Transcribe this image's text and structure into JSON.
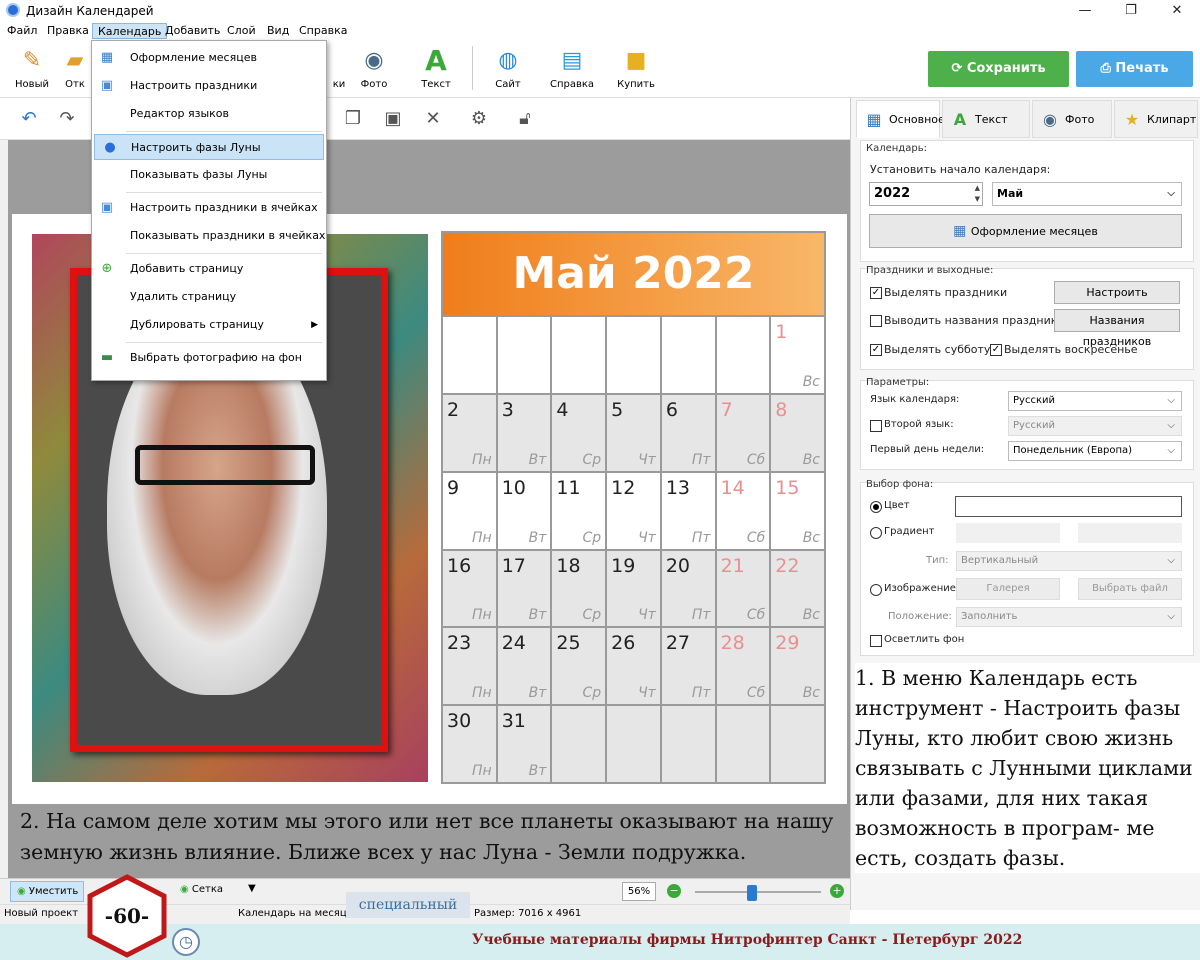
{
  "window": {
    "title": "Дизайн Календарей",
    "controls": {
      "minimize": "—",
      "maximize": "❐",
      "close": "✕"
    }
  },
  "menubar": {
    "items": [
      "Файл",
      "Правка",
      "Календарь",
      "Добавить",
      "Слой",
      "Вид",
      "Справка"
    ],
    "active": "Календарь"
  },
  "toolbar": {
    "buttons": [
      {
        "label": "Новый",
        "icon": "new-icon"
      },
      {
        "label": "Отк",
        "icon": "open-icon"
      },
      {
        "label": "ки",
        "icon": "clipart-icon"
      },
      {
        "label": "Фото",
        "icon": "camera-icon"
      },
      {
        "label": "Текст",
        "icon": "text-icon"
      },
      {
        "label": "Сайт",
        "icon": "globe-icon"
      },
      {
        "label": "Справка",
        "icon": "book-icon"
      },
      {
        "label": "Купить",
        "icon": "bag-icon"
      }
    ],
    "save_label": "Сохранить",
    "print_label": "Печать",
    "save_color": "#4eb04a",
    "print_color": "#4aa8e6"
  },
  "dropdown": {
    "items": [
      {
        "label": "Оформление месяцев",
        "icon": "calendar-grid-icon"
      },
      {
        "label": "Настроить праздники",
        "icon": "calendar-31-icon"
      },
      {
        "label": "Редактор языков",
        "icon": ""
      },
      {
        "label": "Настроить фазы Луны",
        "icon": "moon-icon",
        "highlighted": true
      },
      {
        "label": "Показывать фазы Луны",
        "icon": ""
      },
      {
        "label": "Настроить праздники в ячейках",
        "icon": "calendar-31-icon"
      },
      {
        "label": "Показывать праздники в ячейках",
        "icon": ""
      },
      {
        "label": "Добавить страницу",
        "icon": "add-page-icon"
      },
      {
        "label": "Удалить страницу",
        "icon": ""
      },
      {
        "label": "Дублировать страницу",
        "icon": "",
        "submenu": true
      },
      {
        "label": "Выбрать фотографию на фон",
        "icon": "photo-icon"
      }
    ]
  },
  "calendar": {
    "title": "Май 2022",
    "weekdays": [
      "Пн",
      "Вт",
      "Ср",
      "Чт",
      "Пт",
      "Сб",
      "Вс"
    ],
    "cells": [
      {
        "n": "",
        "d": ""
      },
      {
        "n": "",
        "d": ""
      },
      {
        "n": "",
        "d": ""
      },
      {
        "n": "",
        "d": ""
      },
      {
        "n": "",
        "d": ""
      },
      {
        "n": "",
        "d": ""
      },
      {
        "n": "1",
        "d": "Вс"
      },
      {
        "n": "2",
        "d": "Пн"
      },
      {
        "n": "3",
        "d": "Вт"
      },
      {
        "n": "4",
        "d": "Ср"
      },
      {
        "n": "5",
        "d": "Чт"
      },
      {
        "n": "6",
        "d": "Пт"
      },
      {
        "n": "7",
        "d": "Сб"
      },
      {
        "n": "8",
        "d": "Вс"
      },
      {
        "n": "9",
        "d": "Пн"
      },
      {
        "n": "10",
        "d": "Вт"
      },
      {
        "n": "11",
        "d": "Ср"
      },
      {
        "n": "12",
        "d": "Чт"
      },
      {
        "n": "13",
        "d": "Пт"
      },
      {
        "n": "14",
        "d": "Сб"
      },
      {
        "n": "15",
        "d": "Вс"
      },
      {
        "n": "16",
        "d": "Пн"
      },
      {
        "n": "17",
        "d": "Вт"
      },
      {
        "n": "18",
        "d": "Ср"
      },
      {
        "n": "19",
        "d": "Чт"
      },
      {
        "n": "20",
        "d": "Пт"
      },
      {
        "n": "21",
        "d": "Сб"
      },
      {
        "n": "22",
        "d": "Вс"
      },
      {
        "n": "23",
        "d": "Пн"
      },
      {
        "n": "24",
        "d": "Вт"
      },
      {
        "n": "25",
        "d": "Ср"
      },
      {
        "n": "26",
        "d": "Чт"
      },
      {
        "n": "27",
        "d": "Пт"
      },
      {
        "n": "28",
        "d": "Сб"
      },
      {
        "n": "29",
        "d": "Вс"
      },
      {
        "n": "30",
        "d": "Пн"
      },
      {
        "n": "31",
        "d": "Вт"
      },
      {
        "n": "",
        "d": ""
      },
      {
        "n": "",
        "d": ""
      },
      {
        "n": "",
        "d": ""
      },
      {
        "n": "",
        "d": ""
      },
      {
        "n": "",
        "d": ""
      }
    ],
    "header_color_start": "#f07d1a",
    "header_color_end": "#f8b768",
    "weekend_color": "#e89090"
  },
  "panel": {
    "tabs": [
      {
        "label": "Основное",
        "icon": "calendar-tab-icon"
      },
      {
        "label": "Текст",
        "icon": "text-tab-icon"
      },
      {
        "label": "Фото",
        "icon": "photo-tab-icon"
      },
      {
        "label": "Клипарт",
        "icon": "star-icon"
      }
    ],
    "calendar_group": {
      "title": "Календарь:",
      "start_label": "Установить начало календаря:",
      "year": "2022",
      "month": "Май",
      "design_button": "Оформление месяцев"
    },
    "holidays_group": {
      "title": "Праздники и выходные:",
      "highlight_holidays": "Выделять праздники",
      "highlight_holidays_checked": true,
      "setup_holidays_button": "Настроить праздники",
      "show_names": "Выводить названия праздников",
      "show_names_checked": false,
      "names_button": "Названия праздников",
      "highlight_saturday": "Выделять субботу",
      "highlight_saturday_checked": true,
      "highlight_sunday": "Выделять воскресенье",
      "highlight_sunday_checked": true
    },
    "params_group": {
      "title": "Параметры:",
      "lang_label": "Язык календаря:",
      "lang_value": "Русский",
      "second_lang_label": "Второй язык:",
      "second_lang_value": "Русский",
      "first_day_label": "Первый день недели:",
      "first_day_value": "Понедельник (Европа)"
    },
    "background_group": {
      "title": "Выбор фона:",
      "color_label": "Цвет",
      "gradient_label": "Градиент",
      "type_label": "Тип:",
      "type_value": "Вертикальный",
      "image_label": "Изображение",
      "gallery_button": "Галерея",
      "choose_file_button": "Выбрать файл",
      "position_label": "Положение:",
      "position_value": "Заполнить",
      "lighten_label": "Осветлить фон"
    }
  },
  "notes": {
    "right": "1. В меню Календарь есть инструмент - Настроить фазы Луны, кто любит свою жизнь связывать с Лунными циклами или фазами, для них такая возможность в програм- ме есть, создать фазы.",
    "bottom": "2. На самом деле хотим мы этого или нет все планеты оказывают на нашу земную жизнь влияние. Ближе всех у нас Луна - Земли подружка."
  },
  "status": {
    "fit_label": "Уместить",
    "grid_label": "Сетка",
    "zoom": "56%",
    "zoom_level": 0.45,
    "project": "Новый проект",
    "type": "Календарь на месяц",
    "size": "Размер: 7016 x 4961"
  },
  "overlay": {
    "page_number": "-60-",
    "special": "специальный",
    "footer_text": "Учебные материалы фирмы Нитрофинтер  Санкт - Петербург  2022",
    "footer_color": "#8b1a1a"
  }
}
